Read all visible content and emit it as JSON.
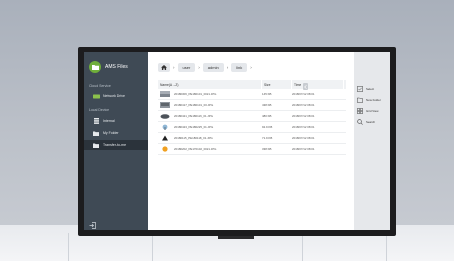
{
  "app": {
    "title": "AMS Files",
    "logo_icon": "folder-icon",
    "accent": "#6fae3a"
  },
  "sidebar": {
    "cloud_label": "Cloud Service",
    "cloud_items": [
      {
        "label": "Network Drive",
        "icon": "cloud-drive-icon"
      }
    ],
    "local_label": "Local Device",
    "local_items": [
      {
        "label": "Internal",
        "icon": "storage-icon"
      },
      {
        "label": "My Folder",
        "icon": "folder-icon"
      },
      {
        "label": "Transfer-to-me",
        "icon": "transfer-icon"
      }
    ],
    "selected": "Transfer-to-me"
  },
  "breadcrumb": [
    "user",
    "admin",
    "link"
  ],
  "table": {
    "headers": {
      "name": "Name(A→Z)",
      "size": "Size",
      "time": "Time"
    },
    "rows": [
      {
        "name": "20180306_PE180101_0021.JPG",
        "size": "145 KB",
        "time": "2018/07/12 08:01"
      },
      {
        "name": "20180417_PE180101_03.JPG",
        "size": "438 KB",
        "time": "2018/07/12 08:01"
      },
      {
        "name": "20180421_PE180116_01.JPG",
        "size": "480 KB",
        "time": "2018/07/12 08:01"
      },
      {
        "name": "20180423_PE180225_01.JPG",
        "size": "92.9 KB",
        "time": "2018/07/12 08:01"
      },
      {
        "name": "20180115_PE180118_01.JPG",
        "size": "71.9 KB",
        "time": "2018/07/12 08:01"
      },
      {
        "name": "20180202_PE170102_0021.JPG",
        "size": "338 KB",
        "time": "2018/07/12 08:01"
      }
    ]
  },
  "actions": [
    {
      "label": "Select",
      "icon": "select-icon"
    },
    {
      "label": "New Folder",
      "icon": "new-folder-icon"
    },
    {
      "label": "Grid View",
      "icon": "grid-view-icon"
    },
    {
      "label": "Search",
      "icon": "search-icon"
    }
  ]
}
